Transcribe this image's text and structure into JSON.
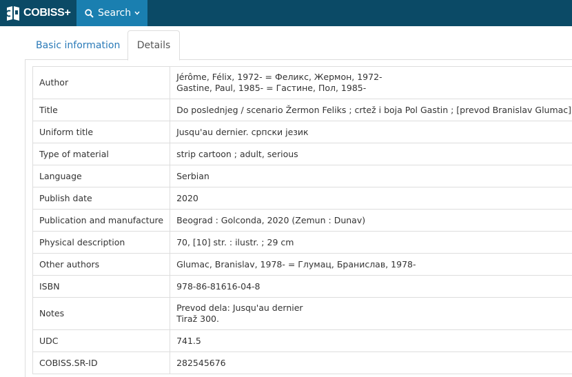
{
  "header": {
    "logo_text": "COBISS+",
    "search_label": "Search",
    "colors": {
      "bar": "#0b4a66",
      "search_tab": "#1a7fb0"
    }
  },
  "tabs": [
    {
      "label": "Basic information",
      "active": false
    },
    {
      "label": "Details",
      "active": true
    }
  ],
  "details": {
    "rows": [
      {
        "label": "Author",
        "values": [
          "Jérôme, Félix, 1972- = Феликс, Жермон, 1972-",
          "Gastine, Paul, 1985- = Гастине, Пол, 1985-"
        ]
      },
      {
        "label": "Title",
        "values": [
          "Do poslednjeg / scenario Žermon Feliks ; crtež i boja Pol Gastin ; [prevod Branislav Glumac]"
        ]
      },
      {
        "label": "Uniform title",
        "values": [
          "Jusqu'au dernier. српски језик"
        ]
      },
      {
        "label": "Type of material",
        "values": [
          "strip cartoon ; adult, serious"
        ]
      },
      {
        "label": "Language",
        "values": [
          "Serbian"
        ]
      },
      {
        "label": "Publish date",
        "values": [
          "2020"
        ]
      },
      {
        "label": "Publication and manufacture",
        "values": [
          "Beograd : Golconda, 2020 (Zemun : Dunav)"
        ]
      },
      {
        "label": "Physical description",
        "values": [
          "70, [10] str. : ilustr. ; 29 cm"
        ]
      },
      {
        "label": "Other authors",
        "values": [
          "Glumac, Branislav, 1978- = Глумац, Бранислав, 1978-"
        ]
      },
      {
        "label": "ISBN",
        "values": [
          "978-86-81616-04-8"
        ]
      },
      {
        "label": "Notes",
        "values": [
          "Prevod dela: Jusqu'au dernier",
          "Tiraž 300."
        ]
      },
      {
        "label": "UDC",
        "values": [
          "741.5"
        ]
      },
      {
        "label": "COBISS.SR-ID",
        "values": [
          "282545676"
        ]
      }
    ]
  }
}
